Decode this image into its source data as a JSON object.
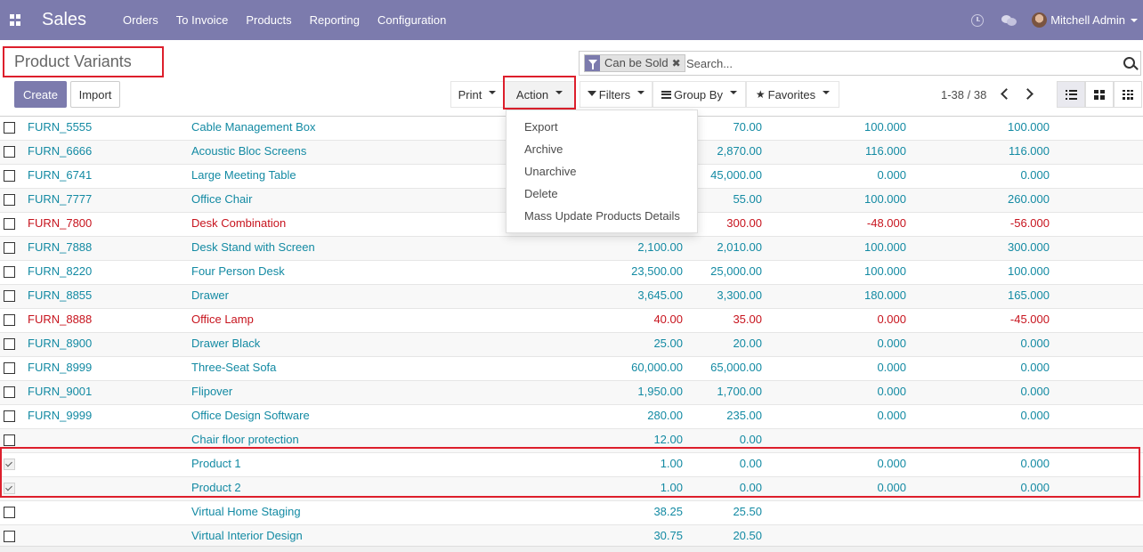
{
  "navbar": {
    "app_name": "Sales",
    "menu": [
      "Orders",
      "To Invoice",
      "Products",
      "Reporting",
      "Configuration"
    ],
    "user_name": "Mitchell Admin",
    "color": "#7c7bad"
  },
  "breadcrumb": {
    "title": "Product Variants"
  },
  "search": {
    "facet_label": "Can be Sold",
    "facet_icon": "filter-icon",
    "placeholder": "Search..."
  },
  "buttons": {
    "create": "Create",
    "import": "Import",
    "print": "Print",
    "action": "Action",
    "filters": "Filters",
    "group_by": "Group By",
    "favorites": "Favorites"
  },
  "pager": {
    "value": "1-38 / 38"
  },
  "action_menu": {
    "items": [
      "Export",
      "Archive",
      "Unarchive",
      "Delete",
      "Mass Update Products Details"
    ]
  },
  "colors": {
    "link": "#138aa3",
    "negative": "#c7141e",
    "highlight_box": "#dd1f2c"
  },
  "rows": [
    {
      "ref": "FURN_5555",
      "name": "Cable Management Box",
      "c1": "",
      "c2": "70.00",
      "c3": "100.000",
      "c4": "100.000",
      "checked": false,
      "warn": false
    },
    {
      "ref": "FURN_6666",
      "name": "Acoustic Bloc Screens",
      "c1": "",
      "c2": "2,870.00",
      "c3": "116.000",
      "c4": "116.000",
      "checked": false,
      "warn": false
    },
    {
      "ref": "FURN_6741",
      "name": "Large Meeting Table",
      "c1": "",
      "c2": "45,000.00",
      "c3": "0.000",
      "c4": "0.000",
      "checked": false,
      "warn": false
    },
    {
      "ref": "FURN_7777",
      "name": "Office Chair",
      "c1": "",
      "c2": "55.00",
      "c3": "100.000",
      "c4": "260.000",
      "checked": false,
      "warn": false
    },
    {
      "ref": "FURN_7800",
      "name": "Desk Combination",
      "c1": "",
      "c2": "300.00",
      "c3": "-48.000",
      "c4": "-56.000",
      "checked": false,
      "warn": true
    },
    {
      "ref": "FURN_7888",
      "name": "Desk Stand with Screen",
      "c1": "2,100.00",
      "c2": "2,010.00",
      "c3": "100.000",
      "c4": "300.000",
      "checked": false,
      "warn": false
    },
    {
      "ref": "FURN_8220",
      "name": "Four Person Desk",
      "c1": "23,500.00",
      "c2": "25,000.00",
      "c3": "100.000",
      "c4": "100.000",
      "checked": false,
      "warn": false
    },
    {
      "ref": "FURN_8855",
      "name": "Drawer",
      "c1": "3,645.00",
      "c2": "3,300.00",
      "c3": "180.000",
      "c4": "165.000",
      "checked": false,
      "warn": false
    },
    {
      "ref": "FURN_8888",
      "name": "Office Lamp",
      "c1": "40.00",
      "c2": "35.00",
      "c3": "0.000",
      "c4": "-45.000",
      "checked": false,
      "warn": true
    },
    {
      "ref": "FURN_8900",
      "name": "Drawer Black",
      "c1": "25.00",
      "c2": "20.00",
      "c3": "0.000",
      "c4": "0.000",
      "checked": false,
      "warn": false
    },
    {
      "ref": "FURN_8999",
      "name": "Three-Seat Sofa",
      "c1": "60,000.00",
      "c2": "65,000.00",
      "c3": "0.000",
      "c4": "0.000",
      "checked": false,
      "warn": false
    },
    {
      "ref": "FURN_9001",
      "name": "Flipover",
      "c1": "1,950.00",
      "c2": "1,700.00",
      "c3": "0.000",
      "c4": "0.000",
      "checked": false,
      "warn": false
    },
    {
      "ref": "FURN_9999",
      "name": "Office Design Software",
      "c1": "280.00",
      "c2": "235.00",
      "c3": "0.000",
      "c4": "0.000",
      "checked": false,
      "warn": false
    },
    {
      "ref": "",
      "name": "Chair floor protection",
      "c1": "12.00",
      "c2": "0.00",
      "c3": "",
      "c4": "",
      "checked": false,
      "warn": false
    },
    {
      "ref": "",
      "name": "Product 1",
      "c1": "1.00",
      "c2": "0.00",
      "c3": "0.000",
      "c4": "0.000",
      "checked": true,
      "warn": false
    },
    {
      "ref": "",
      "name": "Product 2",
      "c1": "1.00",
      "c2": "0.00",
      "c3": "0.000",
      "c4": "0.000",
      "checked": true,
      "warn": false
    },
    {
      "ref": "",
      "name": "Virtual Home Staging",
      "c1": "38.25",
      "c2": "25.50",
      "c3": "",
      "c4": "",
      "checked": false,
      "warn": false
    },
    {
      "ref": "",
      "name": "Virtual Interior Design",
      "c1": "30.75",
      "c2": "20.50",
      "c3": "",
      "c4": "",
      "checked": false,
      "warn": false
    }
  ]
}
